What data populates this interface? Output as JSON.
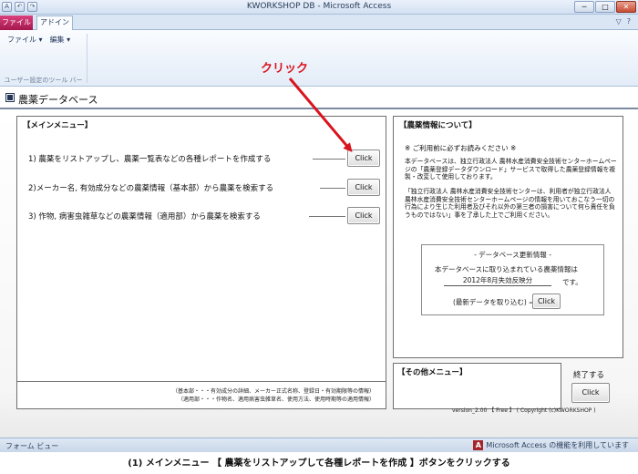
{
  "window": {
    "title": "KWORKSHOP DB - Microsoft Access",
    "minimize": "─",
    "maximize": "□",
    "close": "✕"
  },
  "quick_access": [
    "A",
    "↶",
    "↷"
  ],
  "ribbon": {
    "tabs": [
      "ファイル",
      "アドイン"
    ],
    "help_icons": [
      "▽",
      "?"
    ],
    "menus": [
      "ファイル ▾",
      "編集 ▾"
    ],
    "group_label": "ユーザー設定のツール バー"
  },
  "form": {
    "title": "農薬データベース",
    "main_menu": {
      "title": "【メインメニュー】",
      "items": [
        {
          "text": "1) 農薬をリストアップし、農薬一覧表などの各種レポートを作成する",
          "button": "Click"
        },
        {
          "text": "2)メーカー名, 有効成分などの農薬情報（基本部）から農薬を検索する",
          "button": "Click"
        },
        {
          "text": "3) 作物, 病害虫雑草などの農薬情報（適用部）から農薬を検索する",
          "button": "Click"
        }
      ],
      "notes": [
        "（基本部・・・有効成分の詳細、メーカー正式名称、登録日・有効期限等の情報）",
        "（適用部・・・作物名、適用病害虫雑草名、使用方法、使用時期等の適用情報）"
      ]
    },
    "info": {
      "title": "【農薬情報について】",
      "caution": "※ ご利用前に必ずお読みください ※",
      "para1": "本データベースは、独立行政法人 農林水産消費安全技術センターホームページの「農薬登録データダウンロード」サービスで取得した農薬登録情報を複製・改変して使用しております。",
      "para2": "「独立行政法人 農林水産消費安全技術センターは、利用者が独立行政法人 農林水産消費安全技術センターホームページの情報を用いておこなう一切の行為により生じた利用者及びそれ以外の第三者の損害について何ら責任を負うものではない」事を了承した上でご利用ください。",
      "update": {
        "title": "- データベース更新情報 -",
        "text": "本データベースに取り込まれている農薬情報は",
        "date": "2012年8月失効反映分",
        "suffix": "です。",
        "fetch_label": "(最新データを取り込む) ⇒",
        "button": "Click"
      }
    },
    "other_menu": {
      "title": "【その他メニュー】",
      "exit_label": "終了する",
      "exit_button": "Click"
    },
    "version": "version_2.00 【 Free 】 ( Copyright (c)KWORKSHOP )"
  },
  "annotation": {
    "label": "クリック",
    "color": "#d9141e"
  },
  "status": {
    "left": "フォーム ビュー",
    "right_icon": "A",
    "right": "Microsoft Access の機能を利用しています"
  },
  "caption": "(1) メインメニュー 【 農薬をリストアップして各種レポートを作成 】ボタンをクリックする"
}
